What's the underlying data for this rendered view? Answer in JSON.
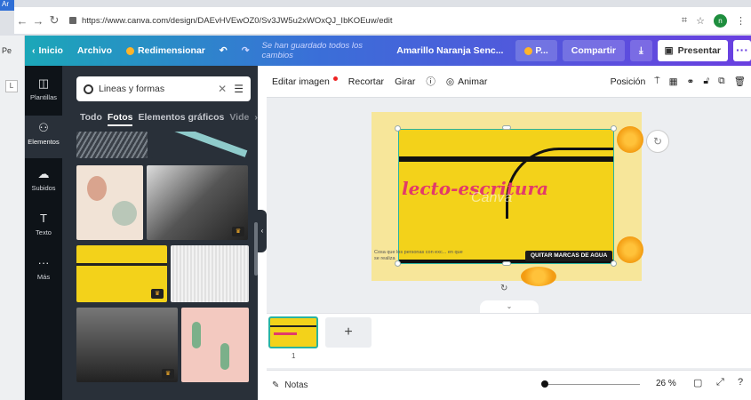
{
  "browser": {
    "tab_label": "Ar",
    "side_label": "Pe",
    "url": "https://www.canva.com/design/DAEvHVEwOZ0/Sv3JW5u2xWOxQJ_IbKOEuw/edit",
    "profile_initial": "n"
  },
  "topbar": {
    "home": "Inicio",
    "file": "Archivo",
    "resize": "Redimensionar",
    "saved": "Se han guardado todos los cambios",
    "doc_title": "Amarillo Naranja Senc...",
    "pro": "P...",
    "share": "Compartir",
    "present": "Presentar",
    "more": "···"
  },
  "leftnav": {
    "items": [
      {
        "label": "Plantillas",
        "icon": "template-icon"
      },
      {
        "label": "Elementos",
        "icon": "elements-icon"
      },
      {
        "label": "Subidos",
        "icon": "upload-icon"
      },
      {
        "label": "Texto",
        "icon": "text-icon"
      },
      {
        "label": "Más",
        "icon": "more-icon"
      }
    ]
  },
  "panel": {
    "search_value": "Lineas y formas",
    "categories": [
      "Todo",
      "Fotos",
      "Elementos gráficos",
      "Vide"
    ]
  },
  "toolbar": {
    "edit_image": "Editar imagen",
    "crop": "Recortar",
    "flip": "Girar",
    "animate": "Animar",
    "position": "Posición"
  },
  "canvas": {
    "headline": "lecto-escritura",
    "watermark": "Canva",
    "remove_watermark": "QUITAR MARCAS DE AGUA",
    "small_text": "Cosa que los personas con exc... en que se realiza"
  },
  "pages": {
    "current": "1",
    "add": "+"
  },
  "bottombar": {
    "notes": "Notas",
    "zoom": "26 %",
    "zoom_fraction": 0.26
  },
  "colors": {
    "accent": "#6a3fe0",
    "teal": "#1ba7b8",
    "panel": "#293039",
    "nav": "#0e1318",
    "yellow": "#f3d21a",
    "headline": "#e23a6a"
  }
}
